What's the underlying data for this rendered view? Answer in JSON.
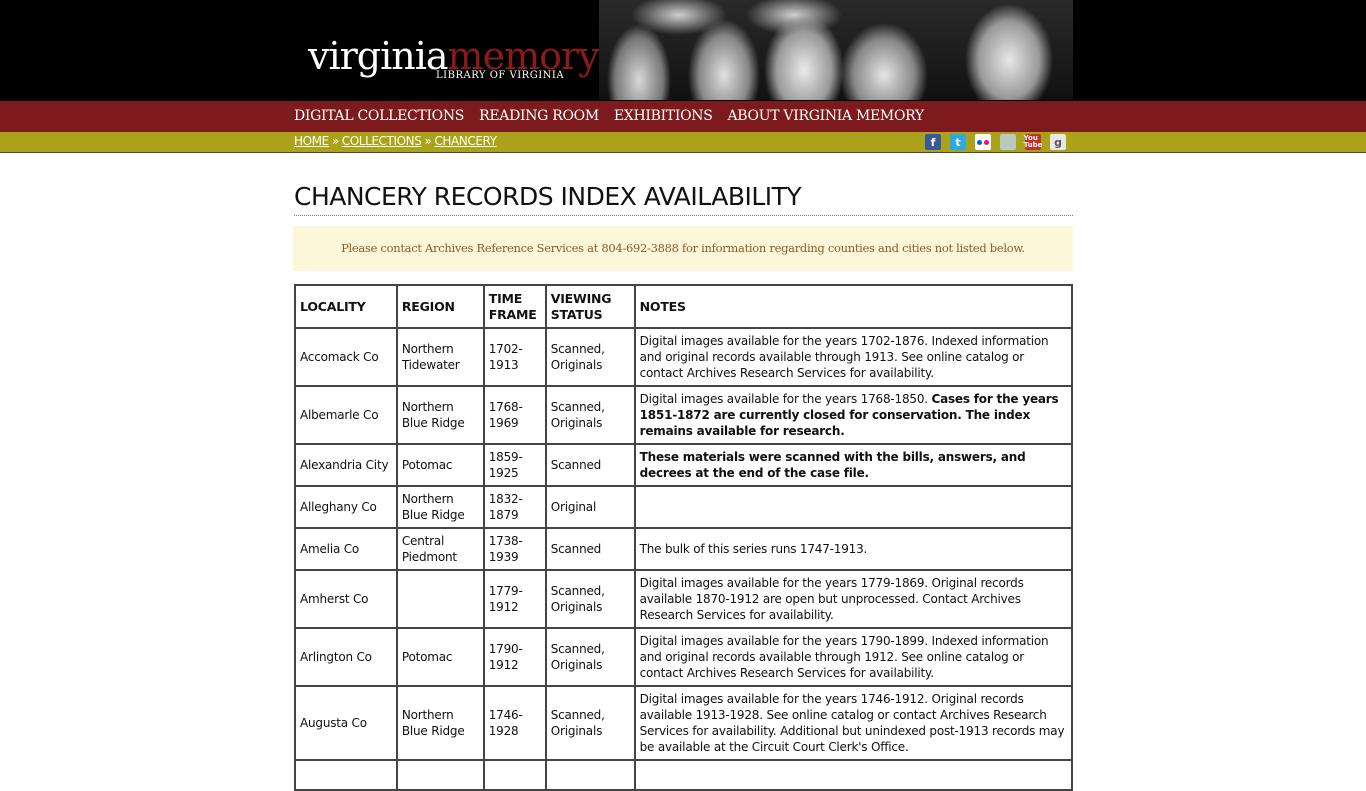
{
  "header": {
    "logo_primary": "virginia",
    "logo_accent": "memory",
    "logo_subtitle": "LIBRARY OF VIRGINIA",
    "banner_alt": "Black and white photograph of women dancing with scarves"
  },
  "nav": {
    "items": [
      {
        "label": "DIGITAL COLLECTIONS"
      },
      {
        "label": "READING ROOM"
      },
      {
        "label": "EXHIBITIONS"
      },
      {
        "label": "ABOUT VIRGINIA MEMORY"
      }
    ]
  },
  "breadcrumb": {
    "items": [
      {
        "label": "HOME"
      },
      {
        "label": "COLLECTIONS"
      },
      {
        "label": "CHANCERY"
      }
    ],
    "separator": "»"
  },
  "social": {
    "icons": [
      {
        "name": "facebook",
        "glyph": "f"
      },
      {
        "name": "twitter",
        "glyph": "t"
      },
      {
        "name": "flickr",
        "glyph": ""
      },
      {
        "name": "blog",
        "glyph": ""
      },
      {
        "name": "youtube",
        "glyph": "You Tube"
      },
      {
        "name": "google",
        "glyph": "g"
      }
    ]
  },
  "page": {
    "title": "CHANCERY RECORDS INDEX AVAILABILITY",
    "notice": "Please contact Archives Reference Services at 804-692-3888 for information regarding counties and cities not listed below."
  },
  "table": {
    "headers": [
      "LOCALITY",
      "REGION",
      "TIME FRAME",
      "VIEWING STATUS",
      "NOTES"
    ],
    "rows": [
      {
        "locality": "Accomack Co",
        "region": "Northern Tidewater",
        "timeframe": "1702-1913",
        "status": "Scanned, Originals",
        "notes_plain": "Digital images available for the years 1702-1876. Indexed information and original records available through 1913. See online catalog or contact Archives Research Services for availability.",
        "notes_bold": ""
      },
      {
        "locality": "Albemarle Co",
        "region": "Northern Blue Ridge",
        "timeframe": "1768-1969",
        "status": "Scanned, Originals",
        "notes_plain": "Digital images available for the years 1768-1850. ",
        "notes_bold": "Cases for the years 1851-1872 are currently closed for conservation. The index remains available for research."
      },
      {
        "locality": "Alexandria City",
        "region": "Potomac",
        "timeframe": "1859-1925",
        "status": "Scanned",
        "notes_plain": "",
        "notes_bold": "These materials were scanned with the bills, answers, and decrees at the end of the case file."
      },
      {
        "locality": "Alleghany Co",
        "region": "Northern Blue Ridge",
        "timeframe": "1832-1879",
        "status": "Original",
        "notes_plain": "",
        "notes_bold": ""
      },
      {
        "locality": "Amelia Co",
        "region": "Central Piedmont",
        "timeframe": "1738-1939",
        "status": "Scanned",
        "notes_plain": "The bulk of this series runs 1747-1913.",
        "notes_bold": ""
      },
      {
        "locality": "Amherst Co",
        "region": "",
        "timeframe": "1779-1912",
        "status": "Scanned, Originals",
        "notes_plain": "Digital images available for the years 1779-1869. Original records available 1870-1912 are open but unprocessed. Contact Archives Research Services for availability.",
        "notes_bold": ""
      },
      {
        "locality": "Arlington Co",
        "region": "Potomac",
        "timeframe": "1790-1912",
        "status": "Scanned, Originals",
        "notes_plain": "Digital images available for the years 1790-1899. Indexed information and original records available through 1912. See online catalog or contact Archives Research Services for availability.",
        "notes_bold": ""
      },
      {
        "locality": "Augusta Co",
        "region": "Northern Blue Ridge",
        "timeframe": "1746-1928",
        "status": "Scanned, Originals",
        "notes_plain": "Digital images available for the years 1746-1912. Original records available 1913-1928. See online catalog or contact Archives Research Services for availability. Additional but unindexed post-1913 records may be available at the Circuit Court Clerk's Office.",
        "notes_bold": ""
      },
      {
        "locality": "",
        "region": "",
        "timeframe": "",
        "status": "",
        "notes_plain": "",
        "notes_bold": ""
      }
    ]
  }
}
